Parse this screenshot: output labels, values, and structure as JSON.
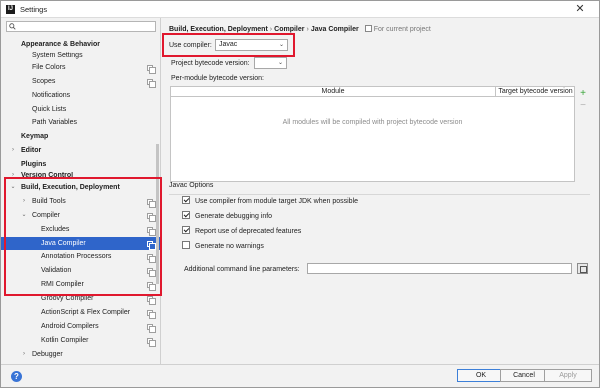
{
  "window": {
    "title": "Settings",
    "app_icon": "intellij-icon",
    "close_glyph": "✕"
  },
  "search": {
    "placeholder": "",
    "value": ""
  },
  "sidebar": {
    "items": [
      {
        "label": "Appearance & Behavior",
        "level": 0,
        "bold": true,
        "arrow": ""
      },
      {
        "label": "System Settings",
        "level": 1,
        "clipped": true
      },
      {
        "label": "File Colors",
        "level": 1,
        "copy": true
      },
      {
        "label": "Scopes",
        "level": 1,
        "copy": true
      },
      {
        "label": "Notifications",
        "level": 1
      },
      {
        "label": "Quick Lists",
        "level": 1
      },
      {
        "label": "Path Variables",
        "level": 1
      },
      {
        "label": "Keymap",
        "level": 0,
        "bold": true
      },
      {
        "label": "Editor",
        "level": 0,
        "bold": true,
        "arrow": "›"
      },
      {
        "label": "Plugins",
        "level": 0,
        "bold": true
      },
      {
        "label": "Version Control",
        "level": 0,
        "bold": true,
        "arrow": "›",
        "clipped": true
      },
      {
        "label": "Build, Execution, Deployment",
        "level": 0,
        "bold": true,
        "arrow": "⌄"
      },
      {
        "label": "Build Tools",
        "level": 1,
        "arrow": "›",
        "copy": true
      },
      {
        "label": "Compiler",
        "level": 1,
        "arrow": "⌄",
        "copy": true
      },
      {
        "label": "Excludes",
        "level": 2,
        "copy": true
      },
      {
        "label": "Java Compiler",
        "level": 2,
        "copy": true,
        "selected": true
      },
      {
        "label": "Annotation Processors",
        "level": 2,
        "copy": true
      },
      {
        "label": "Validation",
        "level": 2,
        "copy": true
      },
      {
        "label": "RMI Compiler",
        "level": 2,
        "copy": true
      },
      {
        "label": "Groovy Compiler",
        "level": 2,
        "copy": true
      },
      {
        "label": "ActionScript & Flex Compiler",
        "level": 2,
        "copy": true
      },
      {
        "label": "Android Compilers",
        "level": 2,
        "copy": true
      },
      {
        "label": "Kotlin Compiler",
        "level": 2,
        "copy": true
      },
      {
        "label": "Debugger",
        "level": 1,
        "arrow": "›"
      }
    ]
  },
  "breadcrumb": {
    "parts": [
      "Build, Execution, Deployment",
      "Compiler",
      "Java Compiler"
    ],
    "separator": "›",
    "scope": "For current project"
  },
  "compiler": {
    "use_compiler_label": "Use compiler:",
    "use_compiler_value": "Javac",
    "bytecode_label": "Project bytecode version:",
    "bytecode_value": "",
    "per_module_label": "Per-module bytecode version:"
  },
  "module_table": {
    "columns": [
      "Module",
      "Target bytecode version"
    ],
    "empty_text": "All modules will be compiled with project bytecode version",
    "add_glyph": "+",
    "remove_glyph": "−"
  },
  "javac_options": {
    "section_title": "Javac Options",
    "checkboxes": [
      {
        "label": "Use compiler from module target JDK when possible",
        "checked": true
      },
      {
        "label": "Generate debugging info",
        "checked": true
      },
      {
        "label": "Report use of deprecated features",
        "checked": true
      },
      {
        "label": "Generate no warnings",
        "checked": false
      }
    ],
    "params_label": "Additional command line parameters:",
    "params_value": ""
  },
  "footer": {
    "help_glyph": "?",
    "ok_label": "OK",
    "cancel_label": "Cancel",
    "apply_label": "Apply"
  },
  "colors": {
    "selection": "#2f65ca",
    "highlight_box": "#e0182e",
    "add_button": "#3aa53a"
  }
}
